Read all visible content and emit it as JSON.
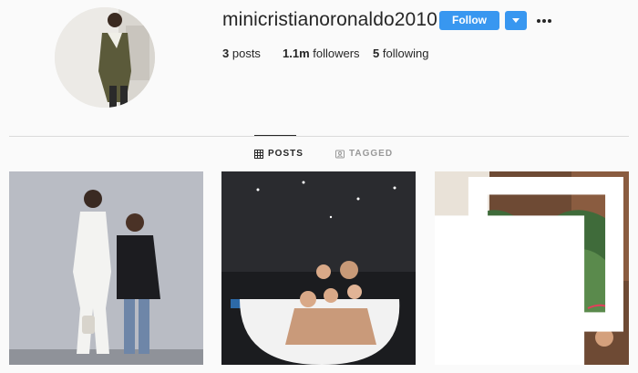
{
  "profile": {
    "username": "minicristianoronaldo2010",
    "follow_label": "Follow",
    "stats": {
      "posts_count": "3",
      "posts_label": "posts",
      "followers_count": "1.1m",
      "followers_label": "followers",
      "following_count": "5",
      "following_label": "following"
    }
  },
  "tabs": [
    {
      "label": "POSTS",
      "icon": "grid-icon",
      "active": true
    },
    {
      "label": "TAGGED",
      "icon": "tag-icon",
      "active": false
    }
  ],
  "posts": [
    {
      "subject": "woman-and-boy-photo"
    },
    {
      "subject": "family-bathtub-photo"
    },
    {
      "subject": "boy-thumbs-up-photo",
      "multi_image": true
    }
  ],
  "colors": {
    "accent": "#3897f0",
    "background": "#fafafa",
    "text": "#262626",
    "muted": "#999999",
    "divider": "#dbdbdb"
  }
}
